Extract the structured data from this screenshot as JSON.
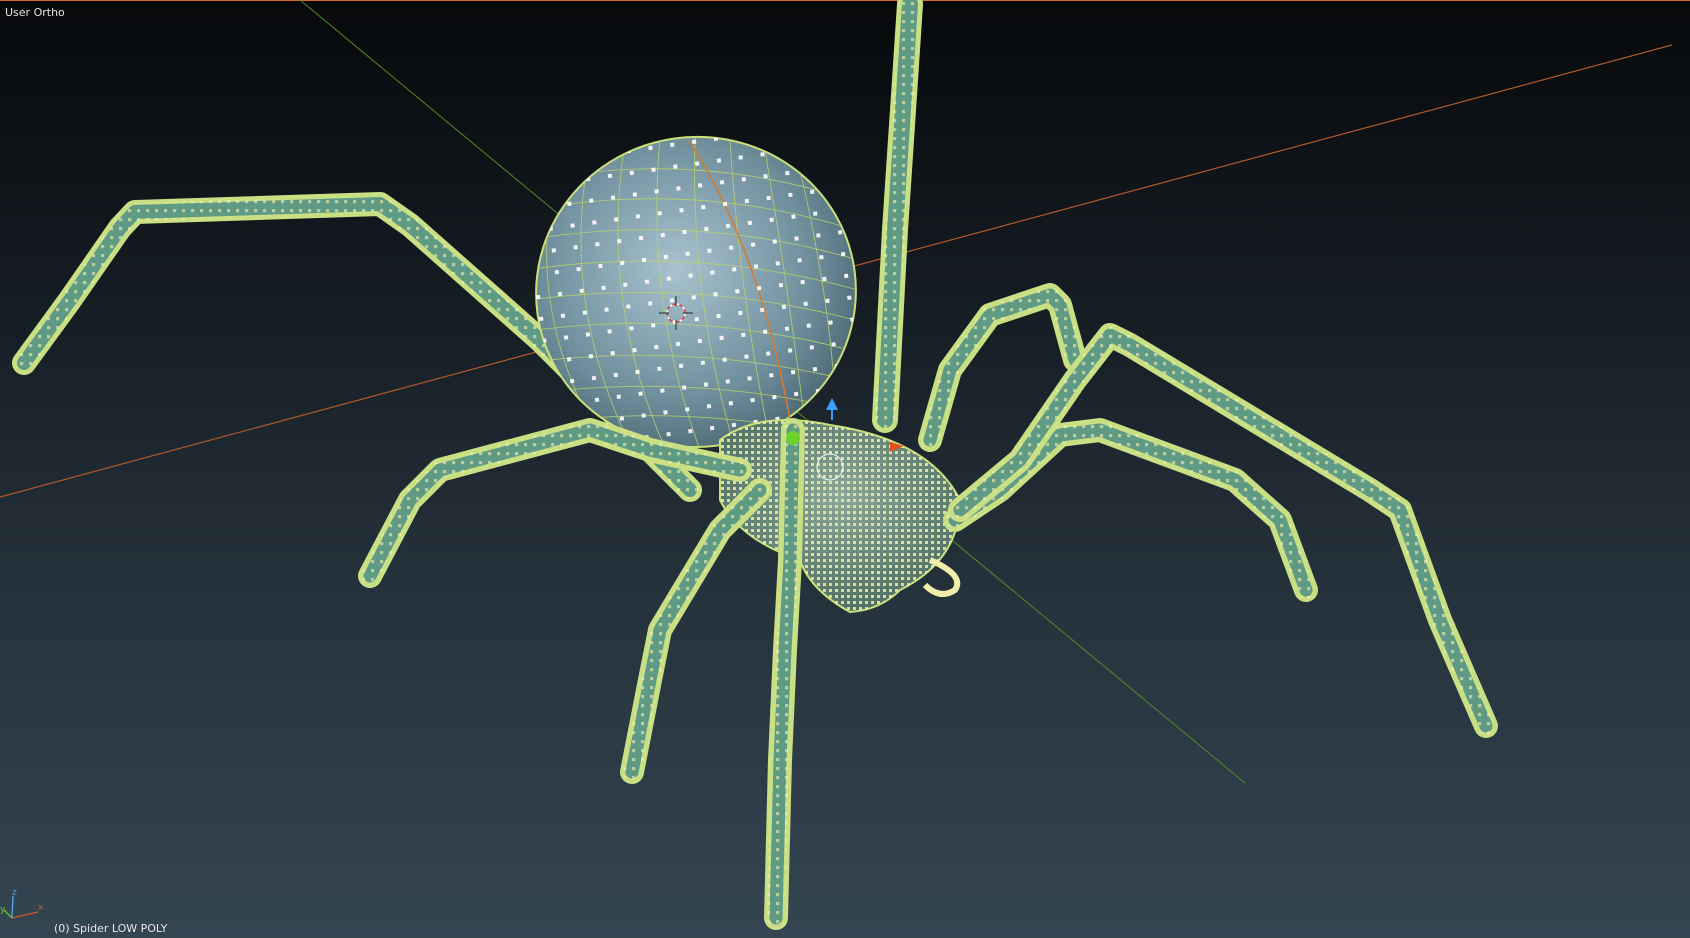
{
  "viewport": {
    "view_label": "User Ortho",
    "object_label": "(0) Spider LOW POLY"
  },
  "gizmo": {
    "x_label": "x",
    "y_label": "y",
    "z_label": "z"
  },
  "scene": {
    "object_name": "Spider LOW POLY",
    "frame": 0,
    "mode": "edit-mode-wireframe",
    "colors": {
      "background_top": "#07090b",
      "background_bottom": "#344552",
      "axis_x": "#c0622c",
      "axis_y": "#5b9a2a",
      "mesh_face": "#7fa0b0",
      "mesh_wire": "#c9e07a",
      "vertex": "#f4f0b0",
      "leg_fill": "#5f9a84",
      "active_border": "#d46a1f"
    }
  }
}
